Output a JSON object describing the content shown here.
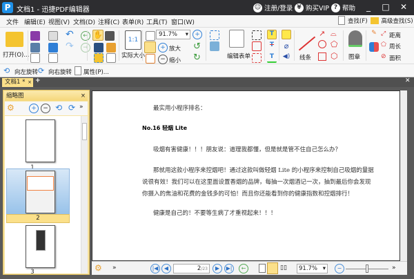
{
  "title": "文档1 - 迅捷PDF编辑器",
  "titlebar": {
    "login": "注册/登录",
    "vip": "购买VIP",
    "help": "帮助"
  },
  "menu": [
    "文件",
    "编辑(E)",
    "视图(V)",
    "文档(D)",
    "注释(C)",
    "表单(R)",
    "工具(T)",
    "窗口(W)"
  ],
  "ribbon": {
    "open": "打开(O)...",
    "actual_size": "实际大小",
    "zoom_value": "91.7%",
    "zoom_in": "放大",
    "zoom_out": "缩小",
    "edit_form": "编辑表单",
    "lines": "线条",
    "stamp": "图章",
    "distance": "距离",
    "perimeter": "周长",
    "area": "面积",
    "find": "查找(F)",
    "advanced_find": "高级查找(S)"
  },
  "quickbar": {
    "rotate_left": "向左旋转",
    "rotate_right": "向右旋转",
    "properties": "属性(P)..."
  },
  "tabs": [
    {
      "label": "文档1 *"
    }
  ],
  "panel": {
    "title": "缩略图",
    "thumbnails": [
      "1",
      "2",
      "3"
    ],
    "selected": "2"
  },
  "document": {
    "lines": [
      "最实用小程序排名：",
      "No.16 轻烟 Lite",
      "吸烟有害健康！！！朋友说：道理我都懂，但是就是管不住自己怎么办？",
      "那就用这款小程序来控烟吧！通过这款叫做轻烟 Lite 的小程序来控制自己吸烟的量据",
      "说很有效！我们可以在这里面设置香烟的品牌，每抽一次烟酒记一次，抽到最后你会发现",
      "你摄入的焦油和花费的金钱多的可怕！而且你还能看到你的健康指数和控烟排行！",
      "健康是自己的！不要等生病了才重视起来！！！"
    ]
  },
  "status": {
    "page": "2",
    "total": "/23",
    "zoom": "91.7%"
  }
}
